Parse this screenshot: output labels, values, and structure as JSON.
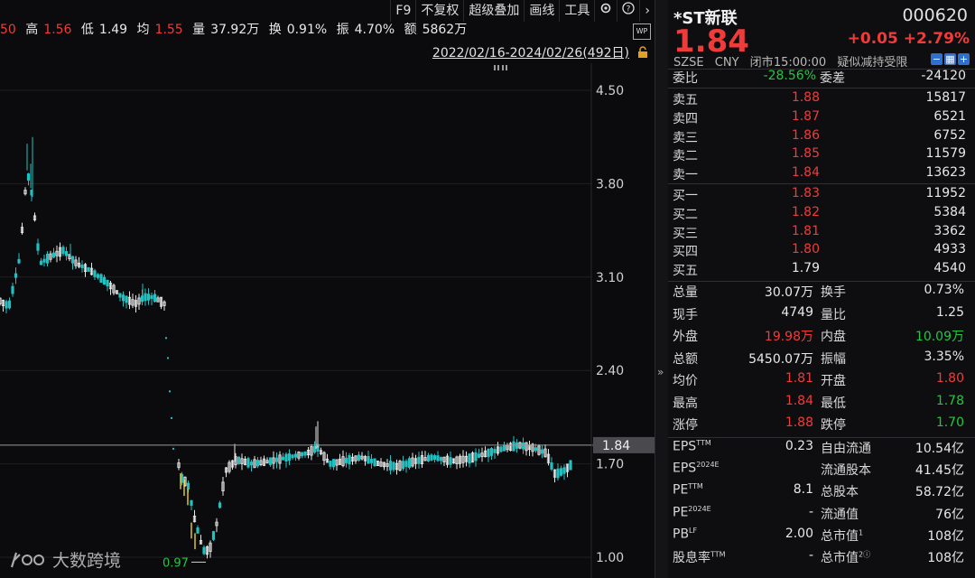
{
  "chart_info": {
    "partial_open": "50",
    "high_label": "高",
    "high": "1.56",
    "low_label": "低",
    "low": "1.49",
    "avg_label": "均",
    "avg": "1.55",
    "vol_label": "量",
    "vol": "37.92万",
    "turnover_label": "换",
    "turnover": "0.91%",
    "amp_label": "振",
    "amp": "4.70%",
    "amount_label": "额",
    "amount": "5862万"
  },
  "toolbar": {
    "f9": "F9",
    "no_adjust": "不复权",
    "overlay": "超级叠加",
    "draw": "画线",
    "tools": "工具",
    "wp": "WP"
  },
  "date_range": "2022/02/16-2024/02/26(492日)",
  "chart_data": {
    "type": "candlestick",
    "y_ticks": [
      "4.50",
      "3.80",
      "3.10",
      "2.40",
      "1.70",
      "1.00"
    ],
    "ylim": [
      1.0,
      4.5
    ],
    "current_price_label": "1.84",
    "current_price": 1.84,
    "min_marker": "0.97",
    "min_value": 0.97,
    "colors": {
      "up": "#e8e8e8",
      "down": "#22c0c0",
      "limit": "#f0d030",
      "price_line": "#9a9a9a"
    }
  },
  "watermark": "大数跨境",
  "quote": {
    "name": "*ST新联",
    "code": "000620",
    "price": "1.84",
    "change": "+0.05",
    "change_pct": "+2.79%",
    "exchange": "SZSE",
    "currency": "CNY",
    "status": "闭市",
    "time": "15:00:00",
    "note": "疑似减持受限",
    "weibi_label": "委比",
    "weibi": "-28.56%",
    "weicha_label": "委差",
    "weicha": "-24120",
    "asks": [
      {
        "label": "卖五",
        "price": "1.88",
        "vol": "15817"
      },
      {
        "label": "卖四",
        "price": "1.87",
        "vol": "6521"
      },
      {
        "label": "卖三",
        "price": "1.86",
        "vol": "6752"
      },
      {
        "label": "卖二",
        "price": "1.85",
        "vol": "11579"
      },
      {
        "label": "卖一",
        "price": "1.84",
        "vol": "13623"
      }
    ],
    "bids": [
      {
        "label": "买一",
        "price": "1.83",
        "vol": "11952"
      },
      {
        "label": "买二",
        "price": "1.82",
        "vol": "5384"
      },
      {
        "label": "买三",
        "price": "1.81",
        "vol": "3362"
      },
      {
        "label": "买四",
        "price": "1.80",
        "vol": "4933"
      },
      {
        "label": "买五",
        "price": "1.79",
        "vol": "4540"
      }
    ],
    "stats": [
      {
        "l1": "总量",
        "v1": "30.07万",
        "l2": "换手",
        "v2": "0.73%"
      },
      {
        "l1": "现手",
        "v1": "4749",
        "l2": "量比",
        "v2": "1.25"
      },
      {
        "l1": "外盘",
        "v1": "19.98万",
        "l2": "内盘",
        "v2": "10.09万"
      },
      {
        "l1": "总额",
        "v1": "5450.07万",
        "l2": "振幅",
        "v2": "3.35%"
      },
      {
        "l1": "均价",
        "v1": "1.81",
        "l2": "开盘",
        "v2": "1.80"
      },
      {
        "l1": "最高",
        "v1": "1.84",
        "l2": "最低",
        "v2": "1.78"
      },
      {
        "l1": "涨停",
        "v1": "1.88",
        "l2": "跌停",
        "v2": "1.70"
      }
    ],
    "fundamentals": [
      {
        "l1": "EPS",
        "s1": "TTM",
        "v1": "0.23",
        "l2": "自由流通",
        "s2": "",
        "v2": "10.54亿"
      },
      {
        "l1": "EPS",
        "s1": "2024E",
        "v1": "",
        "l2": "流通股本",
        "s2": "",
        "v2": "41.45亿"
      },
      {
        "l1": "PE",
        "s1": "TTM",
        "v1": "8.1",
        "l2": "总股本",
        "s2": "",
        "v2": "58.72亿"
      },
      {
        "l1": "PE",
        "s1": "2024E",
        "v1": "-",
        "l2": "流通值",
        "s2": "",
        "v2": "76亿"
      },
      {
        "l1": "PB",
        "s1": "LF",
        "v1": "2.00",
        "l2": "总市值",
        "s2": "1",
        "v2": "108亿"
      },
      {
        "l1": "股息率",
        "s1": "TTM",
        "v1": "-",
        "l2": "总市值",
        "s2": "2ⓘ",
        "v2": "108亿"
      }
    ]
  }
}
